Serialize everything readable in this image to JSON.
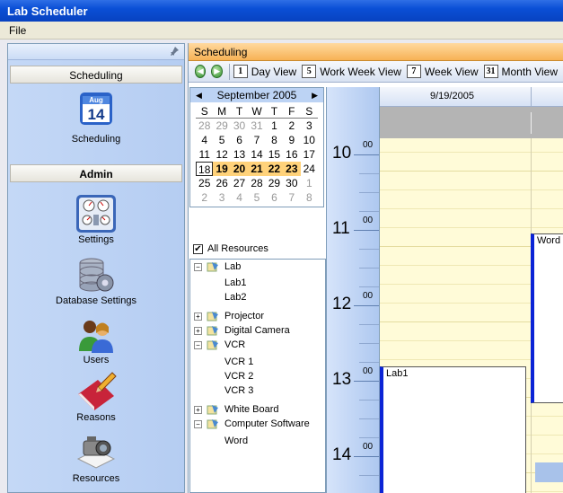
{
  "window": {
    "title": "Lab Scheduler"
  },
  "menu": {
    "file": "File"
  },
  "sidebar": {
    "scheduling_header": "Scheduling",
    "scheduling_item": "Scheduling",
    "calendar_icon_month": "Aug",
    "calendar_icon_day": "14",
    "admin_header": "Admin",
    "items": [
      {
        "label": "Settings",
        "icon": "gauges-icon"
      },
      {
        "label": "Database Settings",
        "icon": "database-gear-icon"
      },
      {
        "label": "Users",
        "icon": "users-icon"
      },
      {
        "label": "Reasons",
        "icon": "book-pencil-icon"
      },
      {
        "label": "Resources",
        "icon": "camera-icon"
      }
    ]
  },
  "main": {
    "title": "Scheduling",
    "toolbar": {
      "day_view": "Day View",
      "day_num": "1",
      "work_week_view": "Work Week View",
      "work_week_num": "5",
      "week_view": "Week View",
      "week_num": "7",
      "month_view": "Month View",
      "month_num": "31"
    },
    "minical": {
      "month": "September 2005",
      "dow": [
        "S",
        "M",
        "T",
        "W",
        "T",
        "F",
        "S"
      ],
      "weeks": [
        [
          "28",
          "29",
          "30",
          "31",
          "1",
          "2",
          "3"
        ],
        [
          "4",
          "5",
          "6",
          "7",
          "8",
          "9",
          "10"
        ],
        [
          "11",
          "12",
          "13",
          "14",
          "15",
          "16",
          "17"
        ],
        [
          "18",
          "19",
          "20",
          "21",
          "22",
          "23",
          "24"
        ],
        [
          "25",
          "26",
          "27",
          "28",
          "29",
          "30",
          "1"
        ],
        [
          "2",
          "3",
          "4",
          "5",
          "6",
          "7",
          "8"
        ]
      ]
    },
    "all_resources": "All Resources",
    "tree": {
      "lab": "Lab",
      "lab1": "Lab1",
      "lab2": "Lab2",
      "projector": "Projector",
      "digital_camera": "Digital Camera",
      "vcr": "VCR",
      "vcr1": "VCR 1",
      "vcr2": "VCR 2",
      "vcr3": "VCR 3",
      "white_board": "White Board",
      "computer_software": "Computer Software",
      "word": "Word"
    },
    "schedule": {
      "date": "9/19/2005",
      "hours": [
        "10",
        "11",
        "12",
        "13",
        "14"
      ],
      "minutes": "00",
      "appointments": {
        "word": "Word",
        "lab1": "Lab1"
      }
    }
  },
  "colors": {
    "accent_blue": "#0b24d6",
    "selected_week": "#ffd27a",
    "title_bar": "#0a4fd6",
    "panel_header": "#f7b255"
  }
}
